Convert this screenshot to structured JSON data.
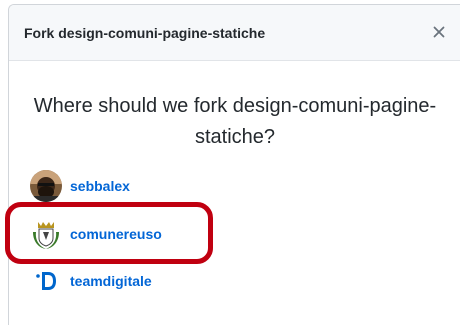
{
  "dialog": {
    "title": "Fork design-comuni-pagine-statiche",
    "close_icon": "close-icon",
    "question": "Where should we fork design-comuni-pagine-statiche?"
  },
  "owners": [
    {
      "name": "sebbalex",
      "avatar": "user-photo-avatar"
    },
    {
      "name": "comunereuso",
      "avatar": "coat-of-arms-avatar"
    },
    {
      "name": "teamdigitale",
      "avatar": "team-digitale-logo-avatar"
    }
  ],
  "colors": {
    "link": "#0366d6",
    "header_bg": "#f6f8fa",
    "highlight": "#c00010"
  }
}
